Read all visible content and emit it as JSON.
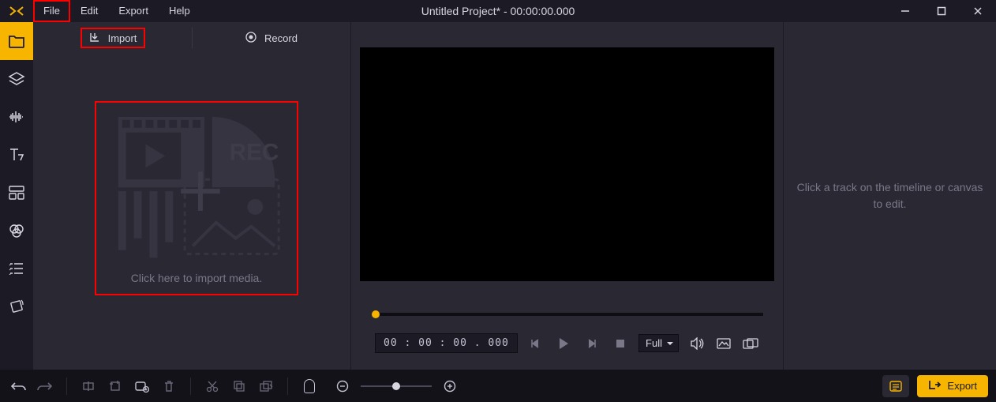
{
  "menu": {
    "file": "File",
    "edit": "Edit",
    "export": "Export",
    "help": "Help"
  },
  "title": "Untitled Project* - 00:00:00.000",
  "media_tabs": {
    "import": "Import",
    "record": "Record"
  },
  "import_dropzone_text": "Click here to import media.",
  "dropzone_rec_label": "REC",
  "preview": {
    "timecode": "00 : 00 : 00 . 000",
    "zoom": "Full"
  },
  "inspector_hint": "Click a track on the timeline or canvas to edit.",
  "bottom": {
    "export_label": "Export"
  },
  "colors": {
    "accent": "#f7b500",
    "highlight": "#ff0000"
  },
  "sidebar_tools": [
    "media-folder",
    "layers",
    "audio-waveform",
    "text",
    "templates",
    "filters",
    "list",
    "rotate"
  ]
}
